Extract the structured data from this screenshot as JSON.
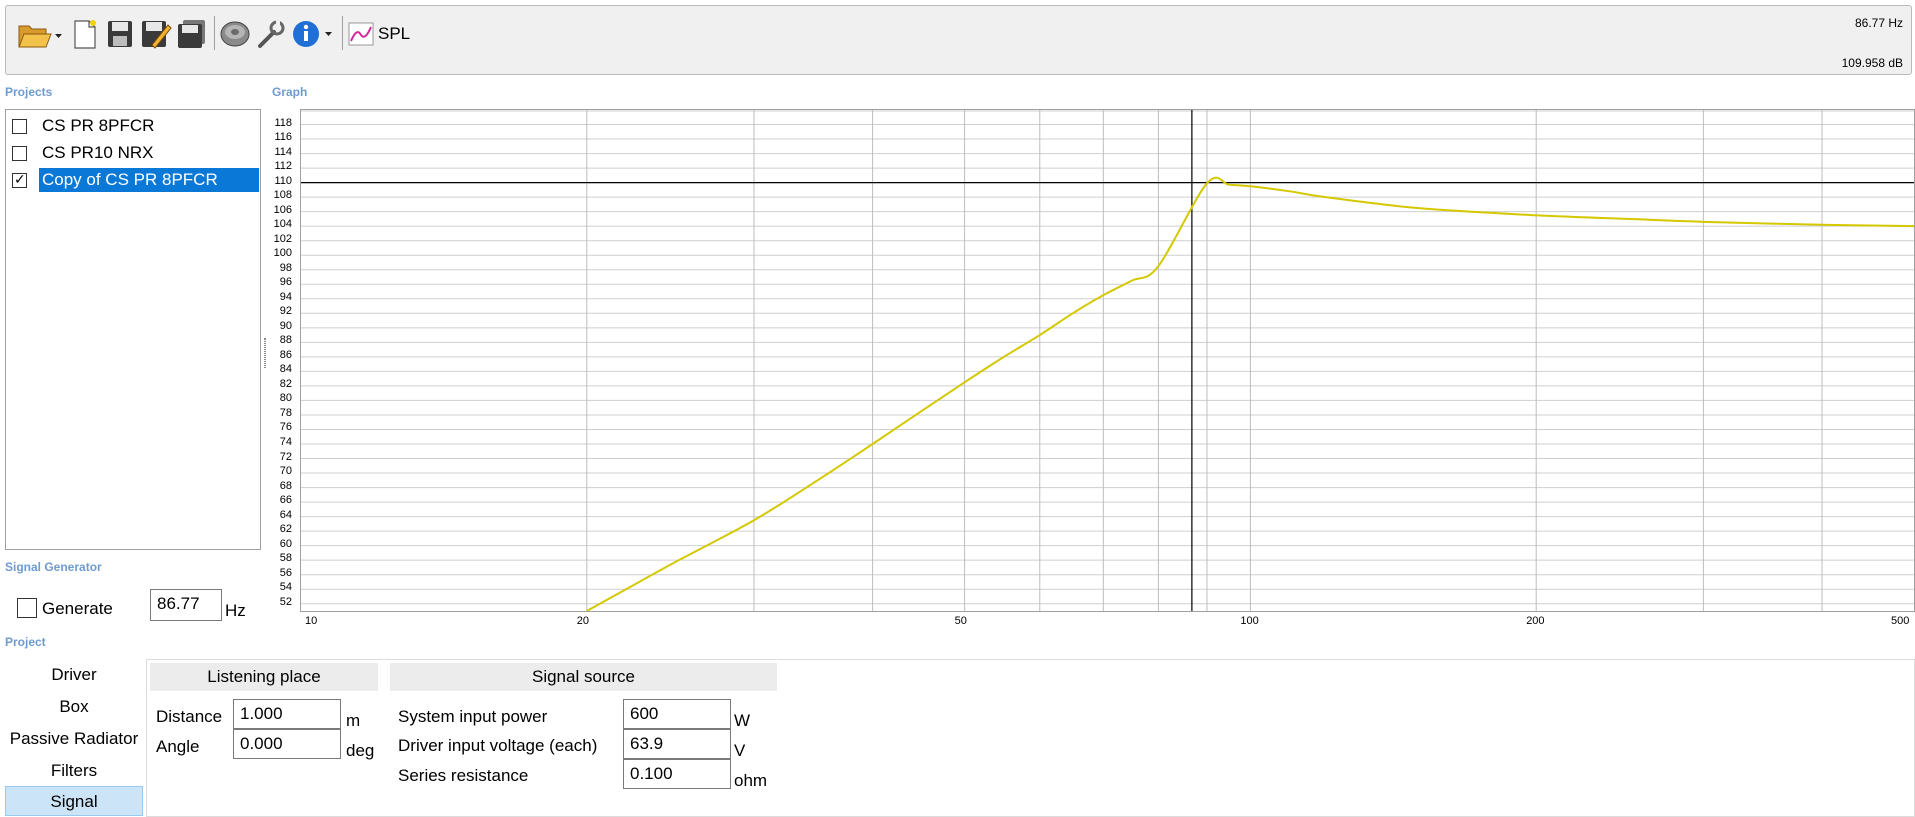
{
  "toolbar": {
    "icons": [
      "folder-open-icon",
      "new-document-icon",
      "save-icon",
      "save-as-icon",
      "save-all-icon",
      "driver-icon",
      "settings-wrench-icon",
      "info-icon",
      "spl-graph-icon"
    ],
    "graph_label": "SPL",
    "readout_freq": "86.77 Hz",
    "readout_db": "109.958 dB"
  },
  "projects": {
    "label": "Projects",
    "items": [
      {
        "name": "CS PR 8PFCR",
        "checked": false,
        "selected": false
      },
      {
        "name": "CS PR10 NRX",
        "checked": false,
        "selected": false
      },
      {
        "name": "Copy of CS PR 8PFCR",
        "checked": true,
        "selected": true
      }
    ]
  },
  "graph": {
    "label": "Graph",
    "curve_color": "#d4c800",
    "cursor": {
      "freq": 86.77,
      "db": 110
    }
  },
  "chart_data": {
    "type": "line",
    "x_scale": "log",
    "xlim": [
      10,
      500
    ],
    "ylim": [
      51,
      120
    ],
    "y_ticks": [
      52,
      54,
      56,
      58,
      60,
      62,
      64,
      66,
      68,
      70,
      72,
      74,
      76,
      78,
      80,
      82,
      84,
      86,
      88,
      90,
      92,
      94,
      96,
      98,
      100,
      102,
      104,
      106,
      108,
      110,
      112,
      114,
      116,
      118
    ],
    "x_tick_labels": [
      10,
      20,
      50,
      100,
      200,
      500
    ],
    "x_minor_grid": [
      30,
      40,
      60,
      70,
      80,
      90,
      300,
      400
    ],
    "series": [
      {
        "x": [
          20,
          22,
          25,
          30,
          35,
          40,
          45,
          50,
          55,
          60,
          65,
          70,
          75,
          80,
          86.77,
          90,
          95,
          100,
          110,
          120,
          150,
          200,
          250,
          300,
          400,
          500
        ],
        "y": [
          51,
          54,
          58,
          63.5,
          69,
          74,
          78.5,
          82.5,
          86,
          89,
          92,
          94.5,
          96.5,
          98.5,
          110,
          109.9,
          109.7,
          109.5,
          108.8,
          108,
          106.5,
          105.5,
          105,
          104.6,
          104.2,
          104
        ]
      }
    ]
  },
  "signal_generator": {
    "label": "Signal Generator",
    "generate_label": "Generate",
    "frequency": "86.77",
    "unit": "Hz"
  },
  "project": {
    "label": "Project",
    "tabs": [
      "Driver",
      "Box",
      "Passive Radiator",
      "Filters",
      "Signal"
    ],
    "active_tab": "Signal",
    "listening_place": {
      "header": "Listening place",
      "distance_label": "Distance",
      "distance_value": "1.000",
      "distance_unit": "m",
      "angle_label": "Angle",
      "angle_value": "0.000",
      "angle_unit": "deg"
    },
    "signal_source": {
      "header": "Signal source",
      "power_label": "System input power",
      "power_value": "600",
      "power_unit": "W",
      "voltage_label": "Driver input voltage (each)",
      "voltage_value": "63.9",
      "voltage_unit": "V",
      "resistance_label": "Series resistance",
      "resistance_value": "0.100",
      "resistance_unit": "ohm"
    }
  }
}
